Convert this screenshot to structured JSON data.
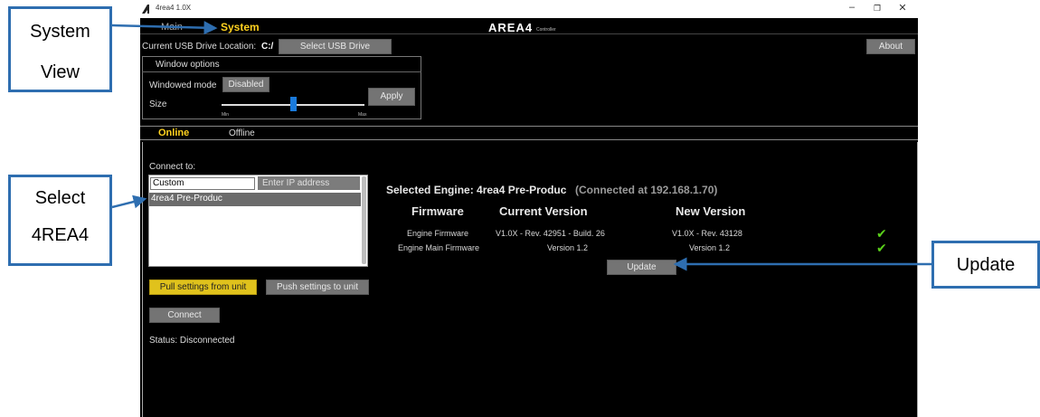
{
  "window": {
    "title": "4rea4 1.0X",
    "minimize": "–",
    "maximize": "❐",
    "close": "✕"
  },
  "nav": {
    "tab_main": "Main",
    "tab_system": "System",
    "logo": "AREA4",
    "logo_sub": "Controller"
  },
  "usb": {
    "label": "Current USB Drive Location:",
    "drive": "C:/",
    "select_button": "Select USB Drive",
    "about_button": "About"
  },
  "window_options": {
    "title": "Window options",
    "windowed_label": "Windowed mode",
    "windowed_value": "Disabled",
    "size_label": "Size",
    "slider_min": "Min",
    "slider_max": "Max",
    "slider_level": 0.5,
    "apply_button": "Apply"
  },
  "mode_tabs": {
    "online": "Online",
    "offline": "Offline",
    "active": "online"
  },
  "connect": {
    "label": "Connect to:",
    "list": [
      {
        "label": "Custom"
      },
      {
        "label": "4rea4 Pre-Produc",
        "selected": true
      }
    ],
    "ip_placeholder": "Enter IP address",
    "pull_button": "Pull settings from unit",
    "push_button": "Push settings to unit",
    "connect_button": "Connect",
    "status": "Status: Disconnected"
  },
  "firmware": {
    "selected_engine": "Selected Engine: 4rea4 Pre-Produc",
    "connected_note": "(Connected at 192.168.1.70)",
    "headers": [
      "Firmware",
      "Current Version",
      "New Version"
    ],
    "rows": [
      {
        "name": "Engine Firmware",
        "current": "V1.0X - Rev. 42951 - Build. 26",
        "new": "V1.0X - Rev. 43128",
        "ok": "✔"
      },
      {
        "name": "Engine Main Firmware",
        "current": "Version 1.2",
        "new": "Version 1.2",
        "ok": "✔"
      }
    ],
    "update_button": "Update"
  },
  "callouts": {
    "system_view": [
      "System",
      "View"
    ],
    "select_4rea4": [
      "Select",
      "4REA4"
    ],
    "update": "Update"
  },
  "colors": {
    "accent_yellow": "#ffd21f",
    "callout_blue": "#2e6eb0",
    "check_green": "#5ad11a",
    "button_gray": "#747474"
  }
}
